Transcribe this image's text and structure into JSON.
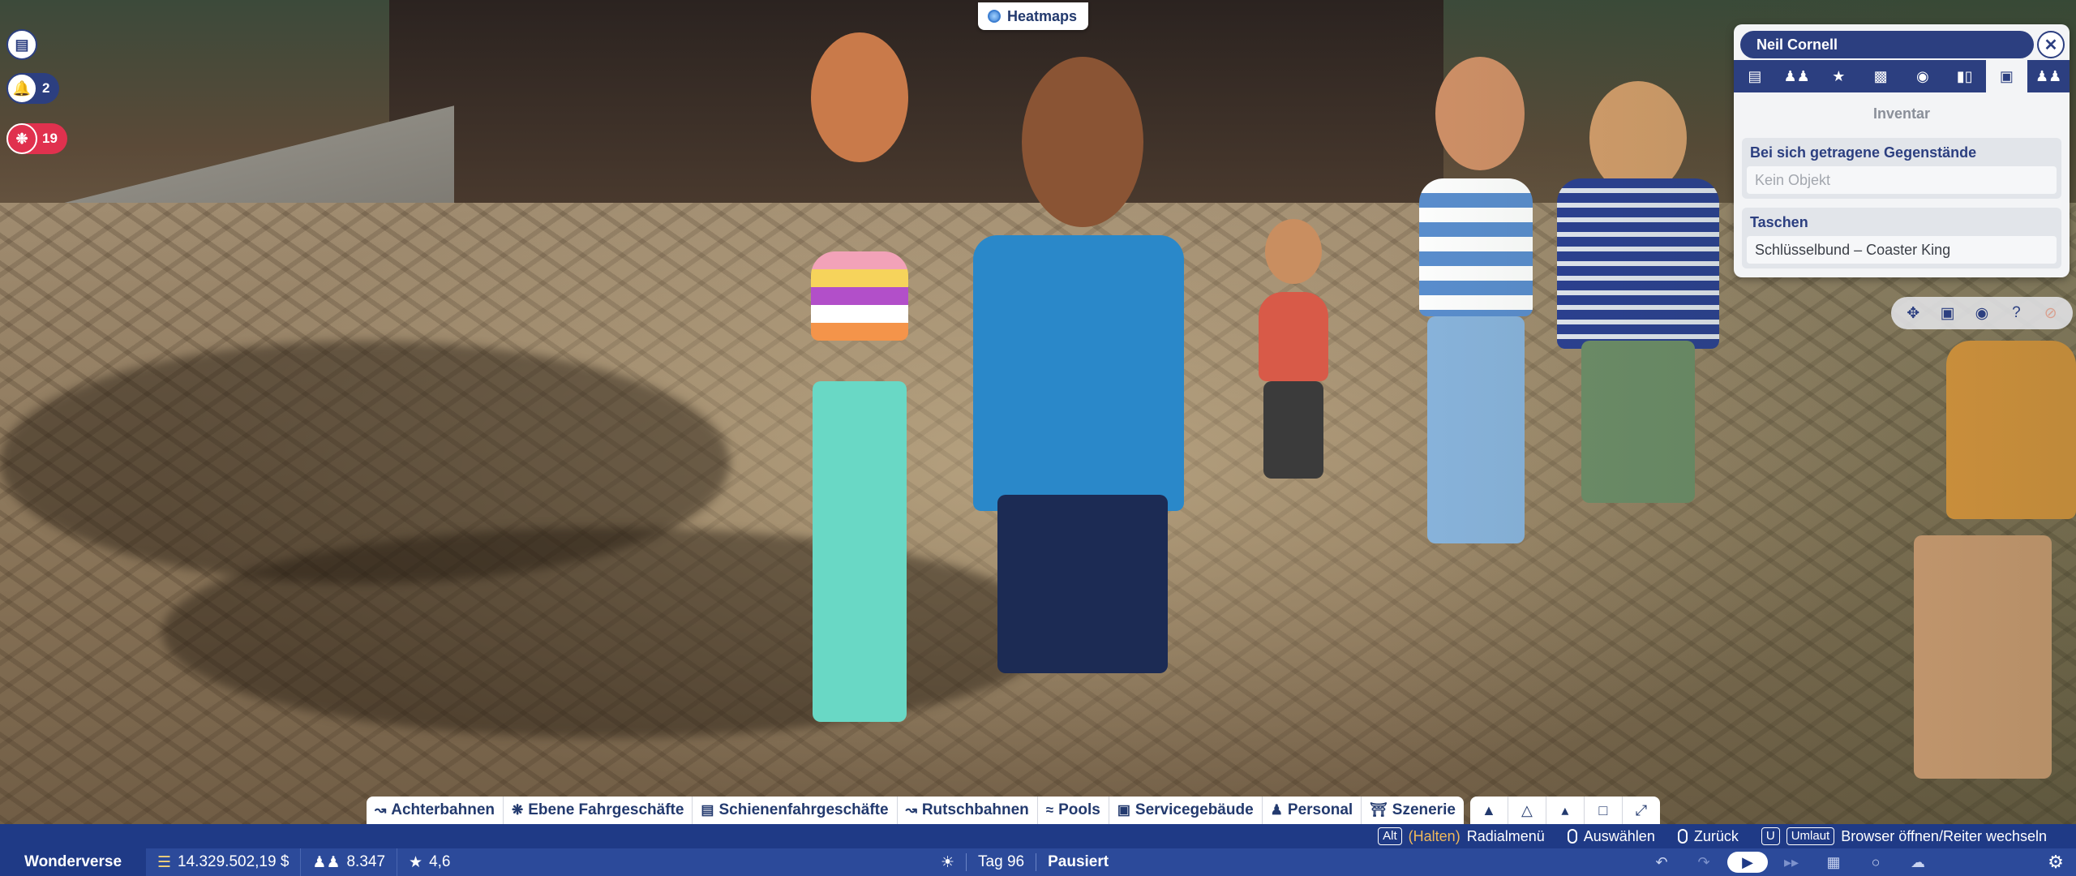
{
  "left_badges": {
    "notifications_count": "2",
    "alerts_count": "19"
  },
  "heatmaps": {
    "label": "Heatmaps"
  },
  "guest_panel": {
    "name": "Neil Cornell",
    "tabs": [
      {
        "icon": "clipboard-icon"
      },
      {
        "icon": "group-icon"
      },
      {
        "icon": "star-icon"
      },
      {
        "icon": "chat-icon"
      },
      {
        "icon": "money-icon"
      },
      {
        "icon": "bar-chart-icon"
      },
      {
        "icon": "inventory-icon",
        "active": true
      },
      {
        "icon": "people-icon"
      }
    ],
    "title": "Inventar",
    "carried_title": "Bei sich getragene Gegenstände",
    "carried_value": "Kein Objekt",
    "pockets_title": "Taschen",
    "pockets_value": "Schlüsselbund – Coaster King"
  },
  "camera_tools": [
    "move-icon",
    "camera-icon",
    "pin-icon",
    "help-icon",
    "disabled-icon"
  ],
  "build_tabs": [
    {
      "label": "Achterbahnen",
      "icon": "coaster-icon"
    },
    {
      "label": "Ebene Fahrgeschäfte",
      "icon": "flat-ride-icon"
    },
    {
      "label": "Schienenfahrgeschäfte",
      "icon": "track-ride-icon"
    },
    {
      "label": "Rutschbahnen",
      "icon": "slide-icon"
    },
    {
      "label": "Pools",
      "icon": "pool-icon"
    },
    {
      "label": "Servicegebäude",
      "icon": "shop-icon"
    },
    {
      "label": "Personal",
      "icon": "staff-icon"
    },
    {
      "label": "Szenerie",
      "icon": "scenery-icon"
    }
  ],
  "hints": {
    "alt_key": "Alt",
    "hold": "(Halten)",
    "radial": "Radialmenü",
    "select": "Auswählen",
    "back": "Zurück",
    "u_key": "U",
    "shift_key": "Umlaut",
    "browser": "Browser öffnen/Reiter wechseln"
  },
  "status": {
    "park_name": "Wonderverse",
    "money": "14.329.502,19 $",
    "guests": "8.347",
    "rating": "4,6",
    "day": "Tag 96",
    "state": "Pausiert"
  },
  "colors": {
    "accent_blue": "#2c3f80",
    "bar_blue": "#2c4a9a",
    "alert_red": "#e0314e"
  }
}
